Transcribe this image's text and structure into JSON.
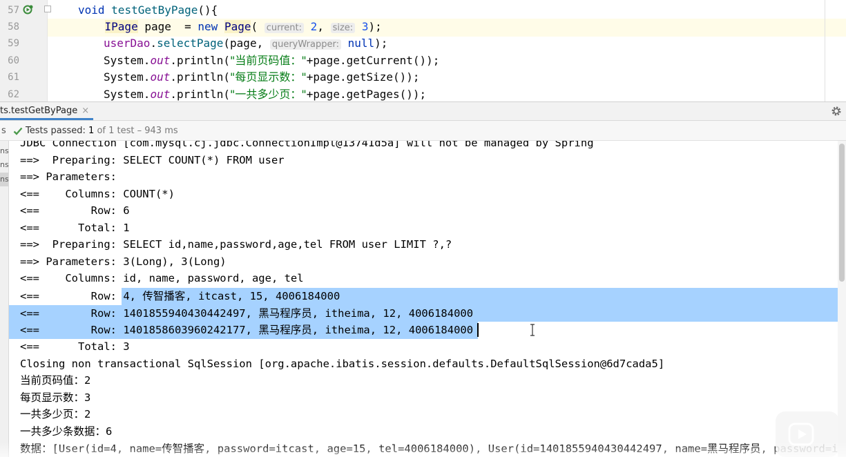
{
  "editor": {
    "line_numbers": [
      "57",
      "58",
      "59",
      "60",
      "61",
      "62"
    ],
    "line57": {
      "kw": "void",
      "name": "testGetByPage",
      "rest": "(){"
    },
    "line58": {
      "type": "IPage",
      "var": " page  = ",
      "kw": "new",
      "cls": "Page",
      "open": "( ",
      "hint1": "current:",
      "v1": "2",
      "comma": ", ",
      "hint2": "size:",
      "v2": "3",
      "close": ");"
    },
    "line59": {
      "field": "userDao",
      "dot": ".",
      "meth": "selectPage",
      "open": "(page, ",
      "hint": "queryWrapper:",
      "kw": "null",
      "close": ");"
    },
    "line60": {
      "pre": "System.",
      "out": "out",
      "mid": ".println(",
      "str": "\"当前页码值：\"",
      "post": "+page.getCurrent());"
    },
    "line61": {
      "pre": "System.",
      "out": "out",
      "mid": ".println(",
      "str": "\"每页显示数：\"",
      "post": "+page.getSize());"
    },
    "line62": {
      "pre": "System.",
      "out": "out",
      "mid": ".println(",
      "str": "\"一共多少页：\"",
      "post": "+page.getPages());"
    }
  },
  "run_window": {
    "tab_label": "ts.testGetByPage",
    "tab_close": "×",
    "status_prefix": "s",
    "status_label": "Tests passed:",
    "status_count": "1",
    "status_rest": " of 1 test – 943 ms",
    "left_strip": [
      "ns",
      "ns",
      "ns"
    ]
  },
  "console": {
    "lines": [
      "JDBC Connection [com.mysql.cj.jdbc.ConnectionImpl@13741d5a] will not be managed by Spring",
      "==>  Preparing: SELECT COUNT(*) FROM user",
      "==> Parameters: ",
      "<==    Columns: COUNT(*)",
      "<==        Row: 6",
      "<==      Total: 1",
      "==>  Preparing: SELECT id,name,password,age,tel FROM user LIMIT ?,?",
      "==> Parameters: 3(Long), 3(Long)",
      "<==    Columns: id, name, password, age, tel",
      "<==        Row: ",
      "<==        Row: ",
      "<==        Row: ",
      "<==      Total: 3",
      "Closing non transactional SqlSession [org.apache.ibatis.session.defaults.DefaultSqlSession@6d7cada5]",
      "当前页码值：2",
      "每页显示数：3",
      "一共多少页：2",
      "一共多少条数据：6",
      "数据：[User(id=4, name=传智播客, password=itcast, age=15, tel=4006184000), User(id=1401855940430442497, name=黑马程序员, password=i"
    ],
    "row_values": [
      "4, 传智播客, itcast, 15, 4006184000",
      "1401855940430442497, 黑马程序员, itheima, 12, 4006184000",
      "1401858603960242177, 黑马程序员, itheima, 12, 4006184000"
    ]
  }
}
